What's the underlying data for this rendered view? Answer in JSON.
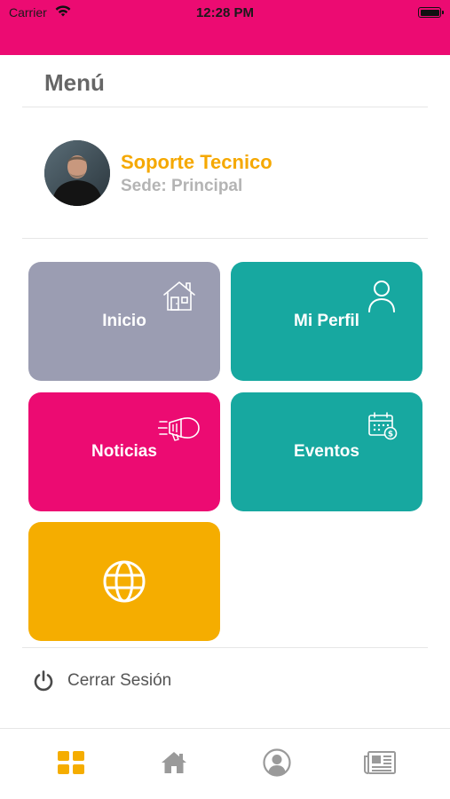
{
  "status_bar": {
    "carrier": "Carrier",
    "time": "12:28 PM"
  },
  "header": {
    "title": "Menú"
  },
  "profile": {
    "name": "Soporte Tecnico",
    "sede": "Sede: Principal"
  },
  "tiles": [
    {
      "label": "Inicio",
      "color": "#9b9db2",
      "icon": "house-icon"
    },
    {
      "label": "Mi Perfil",
      "color": "#17a8a0",
      "icon": "person-icon"
    },
    {
      "label": "Noticias",
      "color": "#ec0b72",
      "icon": "megaphone-icon"
    },
    {
      "label": "Eventos",
      "color": "#17a8a0",
      "icon": "calendar-icon"
    },
    {
      "label": "",
      "color": "#f5ad00",
      "icon": "globe-icon"
    }
  ],
  "logout": {
    "label": "Cerrar Sesión",
    "icon": "power-icon"
  },
  "tabbar": {
    "items": [
      {
        "icon": "grid-icon",
        "active": true
      },
      {
        "icon": "home-icon",
        "active": false
      },
      {
        "icon": "user-icon",
        "active": false
      },
      {
        "icon": "newspaper-icon",
        "active": false
      }
    ],
    "active_color": "#f5ad00",
    "inactive_color": "#9a9a9a"
  },
  "colors": {
    "accent_pink": "#ec0b72",
    "accent_yellow": "#f5a800",
    "teal": "#17a8a0"
  }
}
